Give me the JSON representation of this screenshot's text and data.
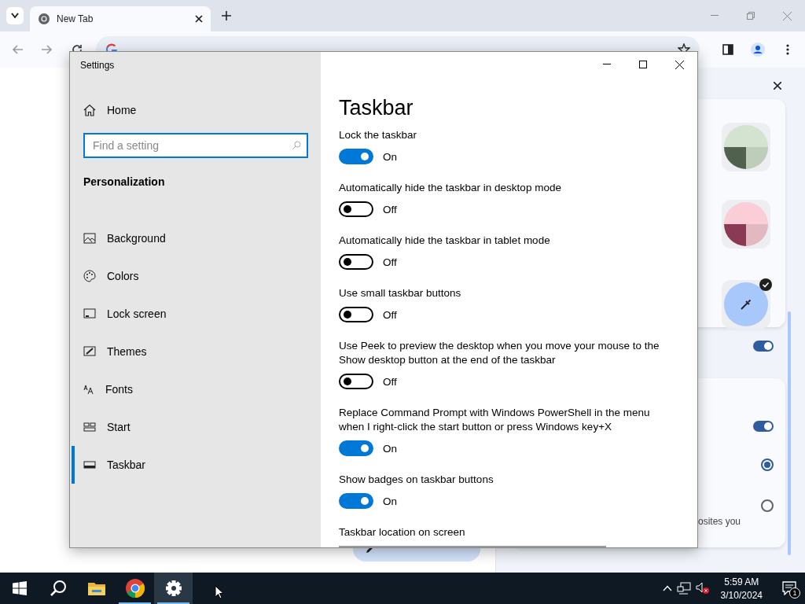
{
  "browser": {
    "tabs": [
      {
        "title": "New Tab",
        "selected": true
      }
    ],
    "side_panel": {
      "swatches": [
        {
          "color": "#d3e3cf",
          "selected": false
        },
        {
          "color": "#fbcdd6",
          "selected": false
        },
        {
          "color": "#a8c7fa",
          "selected": true
        }
      ],
      "toggles": [
        {
          "on": true
        },
        {
          "on": true
        }
      ],
      "radios": [
        {
          "selected": true
        },
        {
          "selected": false
        }
      ],
      "text_fragment": "osites you"
    }
  },
  "settings": {
    "title": "Settings",
    "home": "Home",
    "search": {
      "placeholder": "Find a setting"
    },
    "section": "Personalization",
    "nav": [
      {
        "kind": "background",
        "label": "Background",
        "selected": false
      },
      {
        "kind": "colors",
        "label": "Colors",
        "selected": false
      },
      {
        "kind": "lock",
        "label": "Lock screen",
        "selected": false
      },
      {
        "kind": "themes",
        "label": "Themes",
        "selected": false
      },
      {
        "kind": "fonts",
        "label": "Fonts",
        "selected": false
      },
      {
        "kind": "start",
        "label": "Start",
        "selected": false
      },
      {
        "kind": "taskbar",
        "label": "Taskbar",
        "selected": true
      }
    ],
    "page_title": "Taskbar",
    "options": [
      {
        "kind": "toggle",
        "label": "Lock the taskbar",
        "on": true,
        "state_text": "On"
      },
      {
        "kind": "toggle",
        "label": "Automatically hide the taskbar in desktop mode",
        "on": false,
        "state_text": "Off"
      },
      {
        "kind": "toggle",
        "label": "Automatically hide the taskbar in tablet mode",
        "on": false,
        "state_text": "Off"
      },
      {
        "kind": "toggle",
        "label": "Use small taskbar buttons",
        "on": false,
        "state_text": "Off"
      },
      {
        "kind": "toggle",
        "label": "Use Peek to preview the desktop when you move your mouse to the Show desktop button at the end of the taskbar",
        "on": false,
        "state_text": "Off"
      },
      {
        "kind": "toggle",
        "label": "Replace Command Prompt with Windows PowerShell in the menu when I right-click the start button or press Windows key+X",
        "on": true,
        "state_text": "On"
      },
      {
        "kind": "toggle",
        "label": "Show badges on taskbar buttons",
        "on": true,
        "state_text": "On"
      },
      {
        "kind": "dropdown",
        "label": "Taskbar location on screen"
      }
    ]
  },
  "taskbar": {
    "apps": [
      {
        "kind": "search",
        "running": false,
        "active": false
      },
      {
        "kind": "explorer",
        "running": false,
        "active": false
      },
      {
        "kind": "chrome",
        "running": true,
        "active": false
      },
      {
        "kind": "settings",
        "running": true,
        "active": true
      }
    ],
    "time": "5:59 AM",
    "date": "3/10/2024",
    "notification_count": "1"
  }
}
